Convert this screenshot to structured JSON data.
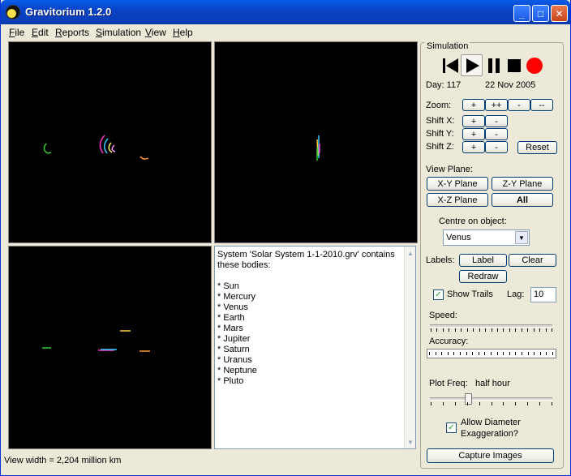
{
  "window": {
    "title": "Gravitorium 1.2.0",
    "controls": {
      "minimize": "_",
      "maximize": "□",
      "close": "✕"
    }
  },
  "menu": [
    {
      "label": "File",
      "key": "F",
      "rest": "ile"
    },
    {
      "label": "Edit",
      "key": "E",
      "rest": "dit"
    },
    {
      "label": "Reports",
      "key": "R",
      "rest": "eports"
    },
    {
      "label": "Simulation",
      "key": "S",
      "rest": "imulation"
    },
    {
      "label": "View",
      "key": "V",
      "rest": "iew"
    },
    {
      "label": "Help",
      "key": "H",
      "rest": "elp"
    }
  ],
  "info": {
    "intro_line1": "System 'Solar System 1-1-2010.grv' contains",
    "intro_line2": "these bodies:",
    "bodies": [
      "* Sun",
      "* Mercury",
      "* Venus",
      "* Earth",
      "* Mars",
      "* Jupiter",
      "* Saturn",
      "* Uranus",
      "* Neptune",
      "* Pluto"
    ]
  },
  "status": {
    "text": "View width = 2,204 million km"
  },
  "simulation": {
    "group_label": "Simulation",
    "day_label": "Day: 117",
    "date": "22 Nov 2005",
    "zoom_label": "Zoom:",
    "zoom_buttons": [
      "+",
      "++",
      "-",
      "--"
    ],
    "shift_x_label": "Shift X:",
    "shift_y_label": "Shift Y:",
    "shift_z_label": "Shift Z:",
    "plus": "+",
    "minus": "-",
    "reset": "Reset",
    "view_plane_label": "View Plane:",
    "plane_xy": "X-Y Plane",
    "plane_zy": "Z-Y Plane",
    "plane_xz": "X-Z Plane",
    "plane_all": "All",
    "centre_label": "Centre on object:",
    "centre_value": "Venus",
    "labels_label": "Labels:",
    "label_button": "Label",
    "clear_button": "Clear",
    "redraw_button": "Redraw",
    "show_trails": "Show Trails",
    "show_trails_checked": true,
    "lag_label": "Lag:",
    "lag_value": "10",
    "speed_label": "Speed:",
    "accuracy_label": "Accuracy:",
    "plot_freq_label": "Plot Freq:",
    "plot_freq_value": "half hour",
    "plot_freq_level": 0.3,
    "diameter_line1": "Allow Diameter",
    "diameter_line2": "Exaggeration?",
    "diameter_checked": true,
    "capture": "Capture Images"
  },
  "colors": {
    "title_blue": "#0a4bd8",
    "record_red": "#ff0000",
    "trail_green": "#33cc33",
    "trail_orange": "#ff9933",
    "trail_magenta": "#ff33cc",
    "trail_cyan": "#33ccff",
    "trail_yellow": "#ffcc33"
  },
  "icons": [
    "skip-back-icon",
    "play-icon",
    "pause-icon",
    "stop-icon",
    "record-icon",
    "chevron-down-icon",
    "check-icon"
  ]
}
